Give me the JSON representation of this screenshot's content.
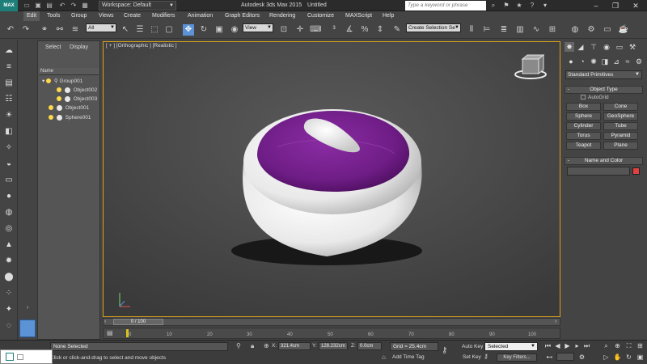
{
  "titlebar": {
    "logo": "MAX",
    "workspace": "Workspace: Default",
    "app_title": "Autodesk 3ds Max  2015",
    "doc_title": "Untitled",
    "search_placeholder": "Type a keyword or phrase"
  },
  "menus": [
    "Edit",
    "Tools",
    "Group",
    "Views",
    "Create",
    "Modifiers",
    "Animation",
    "Graph Editors",
    "Rendering",
    "Customize",
    "MAXScript",
    "Help"
  ],
  "toolbar": {
    "filter": "All",
    "ref_coord": "View",
    "selection_set": "Create Selection Se"
  },
  "scene_explorer": {
    "tab_select": "Select",
    "tab_display": "Display",
    "col_name": "Name",
    "items": [
      {
        "label": "Group001",
        "level": 0,
        "kind": "group"
      },
      {
        "label": "Object002",
        "level": 1,
        "kind": "object"
      },
      {
        "label": "Object003",
        "level": 1,
        "kind": "object"
      },
      {
        "label": "Object001",
        "level": 0,
        "kind": "object"
      },
      {
        "label": "Sphere001",
        "level": 0,
        "kind": "object"
      }
    ]
  },
  "viewport": {
    "label": "[ + ] [Orthographic ] [Realistic ]",
    "colors": {
      "lid": "#6f1d86",
      "body": "#f2f2f2",
      "border": "#d9a31a"
    }
  },
  "command_panel": {
    "category": "Standard Primitives",
    "object_type_title": "Object Type",
    "autogrid": "AutoGrid",
    "buttons": [
      "Box",
      "Cone",
      "Sphere",
      "GeoSphere",
      "Cylinder",
      "Tube",
      "Torus",
      "Pyramid",
      "Teapot",
      "Plane"
    ],
    "name_color_title": "Name and Color",
    "object_color": "#e04040"
  },
  "timeline": {
    "slider": "0 / 100",
    "ticks": [
      "0",
      "10",
      "20",
      "30",
      "40",
      "50",
      "60",
      "70",
      "80",
      "90",
      "100"
    ]
  },
  "statusbar": {
    "selection": "None Selected",
    "prompt": "Click or click-and-drag to select and move objects",
    "x_label": "X:",
    "x_value": "321.4cm",
    "y_label": "Y:",
    "y_value": "128.232cm",
    "z_label": "Z:",
    "z_value": "0.0cm",
    "grid": "Grid = 25.4cm",
    "add_time_tag": "Add Time Tag",
    "auto_key": "Auto Key",
    "set_key": "Set Key",
    "selected": "Selected",
    "key_filters": "Key Filters..."
  }
}
